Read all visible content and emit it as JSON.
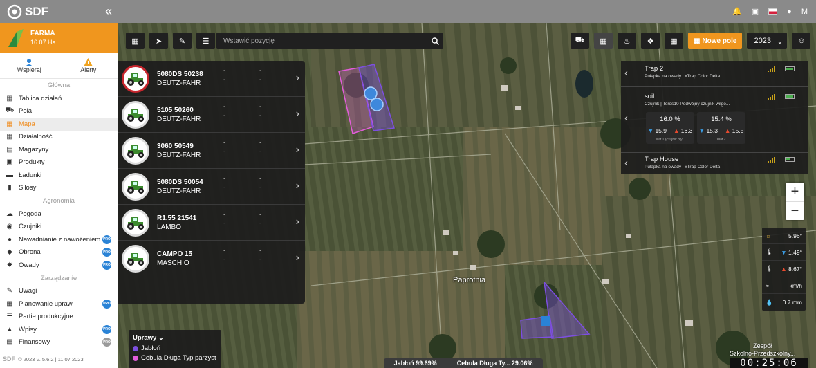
{
  "app": {
    "name": "SDF",
    "user_initial": "M"
  },
  "farm": {
    "name": "FARMA",
    "area": "16.07 Ha"
  },
  "tabs": [
    {
      "label": "Wspieraj",
      "icon": "user-icon"
    },
    {
      "label": "Alerty",
      "icon": "warning-icon"
    }
  ],
  "menu": {
    "section_main": "Główna",
    "main": [
      {
        "label": "Tablica działań",
        "icon": "dashboard-icon"
      },
      {
        "label": "Pola",
        "icon": "tractor-icon"
      },
      {
        "label": "Mapa",
        "icon": "map-icon",
        "active": true
      },
      {
        "label": "Działalność",
        "icon": "activity-icon"
      },
      {
        "label": "Magazyny",
        "icon": "warehouse-icon"
      },
      {
        "label": "Produkty",
        "icon": "box-icon"
      },
      {
        "label": "Ładunki",
        "icon": "truck-icon"
      },
      {
        "label": "Silosy",
        "icon": "silo-icon"
      }
    ],
    "section_agro": "Agronomia",
    "agro": [
      {
        "label": "Pogoda",
        "icon": "cloud-icon"
      },
      {
        "label": "Czujniki",
        "icon": "sensor-icon"
      },
      {
        "label": "Nawadnianie z nawożeniem",
        "icon": "drop-icon",
        "badge": "PRO"
      },
      {
        "label": "Obrona",
        "icon": "shield-icon",
        "badge": "PRO"
      },
      {
        "label": "Owady",
        "icon": "bug-icon",
        "badge": "PRO"
      }
    ],
    "section_mgmt": "Zarządzanie",
    "mgmt": [
      {
        "label": "Uwagi",
        "icon": "note-icon"
      },
      {
        "label": "Planowanie upraw",
        "icon": "plan-icon",
        "badge": "PRO"
      },
      {
        "label": "Partie produkcyjne",
        "icon": "batch-icon"
      },
      {
        "label": "Wpisy",
        "icon": "bell-icon",
        "badge": "PRO"
      },
      {
        "label": "Finansowy",
        "icon": "money-icon",
        "badge": "PRO"
      }
    ]
  },
  "footer": {
    "text": "© 2023 V. 5.6.2 | 11.07 2023",
    "logo": "SDF"
  },
  "search": {
    "placeholder": "Wstawić pozycję"
  },
  "toolbar": {
    "new_field": "Nowe pole",
    "year": "2023"
  },
  "machines": [
    {
      "model": "5080DS 50238",
      "brand": "DEUTZ-FAHR",
      "val1": "-",
      "val2": "-",
      "sub1": "-",
      "sub2": "-",
      "highlight": true
    },
    {
      "model": "5105 50260",
      "brand": "DEUTZ-FAHR",
      "val1": "-",
      "val2": "-",
      "sub1": "-",
      "sub2": "-"
    },
    {
      "model": "3060 50549",
      "brand": "DEUTZ-FAHR",
      "val1": "-",
      "val2": "-",
      "sub1": "-",
      "sub2": "-"
    },
    {
      "model": "5080DS 50054",
      "brand": "DEUTZ-FAHR",
      "val1": "-",
      "val2": "-",
      "sub1": "-",
      "sub2": "-"
    },
    {
      "model": "R1.55 21541",
      "brand": "LAMBO",
      "val1": "-",
      "val2": "-",
      "sub1": "-",
      "sub2": "-"
    },
    {
      "model": "CAMPO 15",
      "brand": "MASCHIO",
      "val1": "-",
      "val2": "-",
      "sub1": "-",
      "sub2": "-"
    }
  ],
  "sensors": {
    "trap2": {
      "title": "Trap 2",
      "subtitle": "Pułapka na owady | xTrap Color Delta"
    },
    "soil": {
      "title": "soil",
      "subtitle": "Czujnik | Teros10 Podwójny czujnik wilgo...",
      "box1": {
        "value": "16.0 %",
        "min": "15.9",
        "max": "16.3",
        "label": "Wat 1 (czujnik pły..."
      },
      "box2": {
        "value": "15.4 %",
        "min": "15.3",
        "max": "15.5",
        "label": "Wat 2"
      }
    },
    "traphouse": {
      "title": "Trap House",
      "subtitle": "Pułapka na owady | xTrap Color Delta"
    }
  },
  "weather": [
    {
      "icon": "sun-icon",
      "value": "5.96°"
    },
    {
      "icon": "thermometer-low-icon",
      "value": "1.49°",
      "dir": "down"
    },
    {
      "icon": "thermometer-high-icon",
      "value": "8.67°",
      "dir": "up"
    },
    {
      "icon": "wind-icon",
      "value": "km/h"
    },
    {
      "icon": "rain-icon",
      "value": "0.7 mm"
    }
  ],
  "legend": {
    "title": "Uprawy",
    "items": [
      {
        "label": "Jabłoń",
        "color": "#7d4fe0"
      },
      {
        "label": "Cebula Długa Typ parzyst",
        "color": "#e35ddb"
      }
    ]
  },
  "cropbar": {
    "left": "Jabłoń 99.69%",
    "right": "Cebula Długa Ty... 29.06%"
  },
  "map": {
    "place": "Paprotnia",
    "school": "Zespół\nSzkolno-Przedszkolny..."
  },
  "timer": "00:25:06",
  "colors": {
    "accent": "#f0961e",
    "pro_badge": "#2a83d6",
    "orchard": "#7d4fe0",
    "onion": "#e35ddb"
  }
}
